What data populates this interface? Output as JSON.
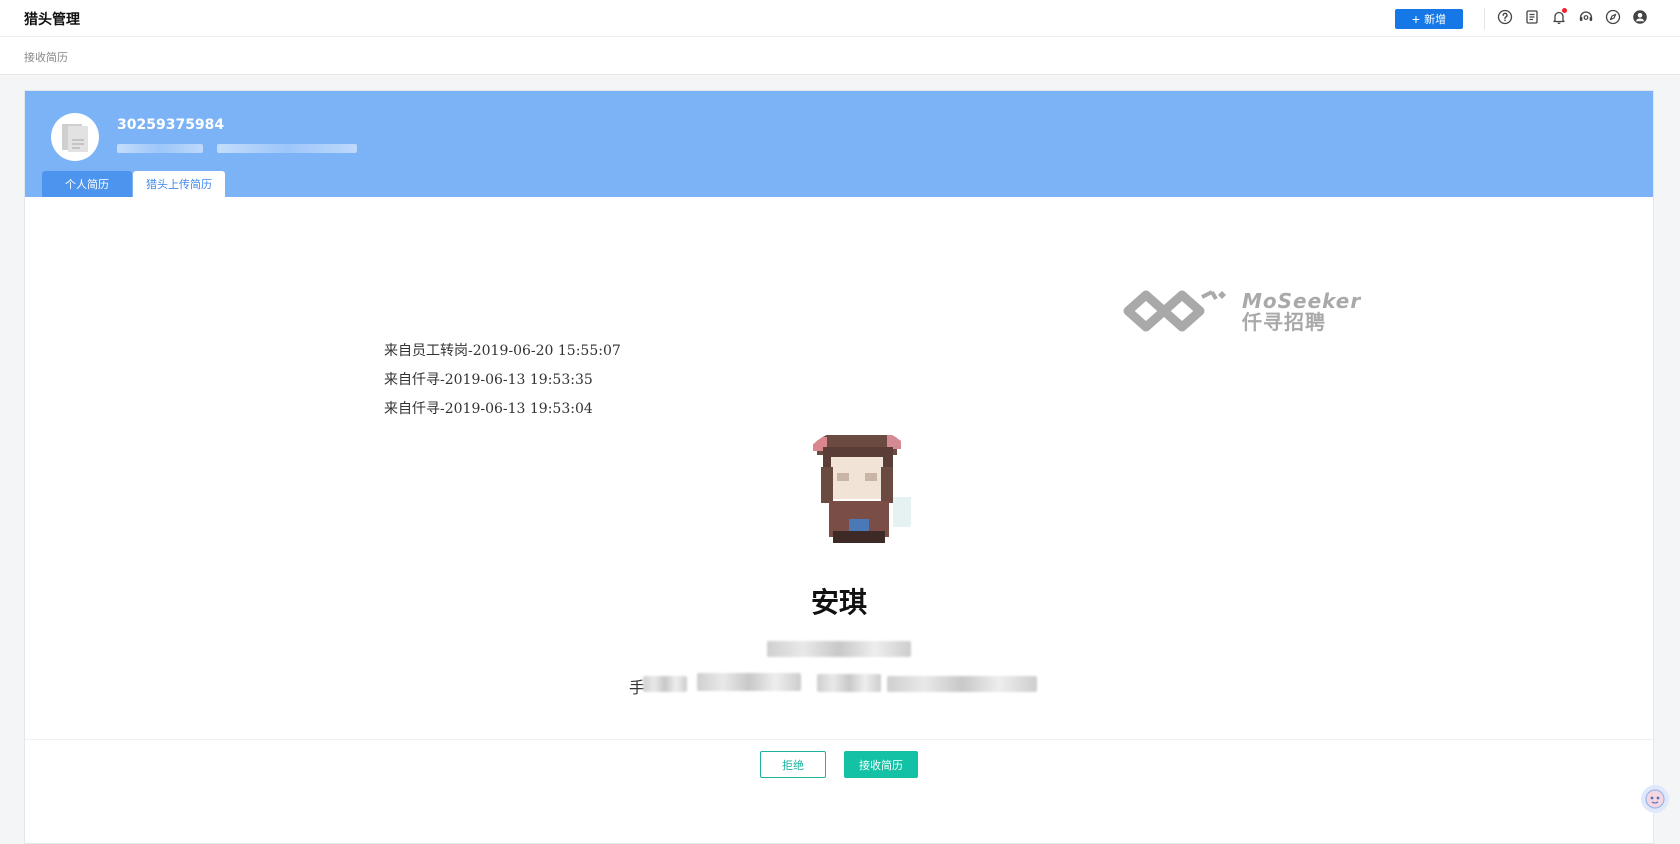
{
  "header": {
    "title": "猎头管理",
    "new_button_label": "新增",
    "icons": [
      "help-icon",
      "document-icon",
      "bell-icon",
      "support-icon",
      "compass-icon",
      "user-icon"
    ]
  },
  "breadcrumb": "接收简历",
  "profile": {
    "candidate_id": "30259375984",
    "tabs": [
      {
        "label": "个人简历",
        "active": false
      },
      {
        "label": "猎头上传简历",
        "active": true
      }
    ]
  },
  "resume": {
    "logo": {
      "en": "MoSeeker",
      "zh": "仟寻招聘"
    },
    "sources": [
      "来自员工转岗-2019-06-20 15:55:07",
      "来自仟寻-2019-06-13 19:53:35",
      "来自仟寻-2019-06-13 19:53:04"
    ],
    "name": "安琪",
    "contact_prefix": "手"
  },
  "actions": {
    "reject_label": "拒绝",
    "accept_label": "接收简历"
  },
  "colors": {
    "header_band": "#7cb3f7",
    "primary": "#1677e6",
    "accent_teal": "#13c2a5"
  }
}
